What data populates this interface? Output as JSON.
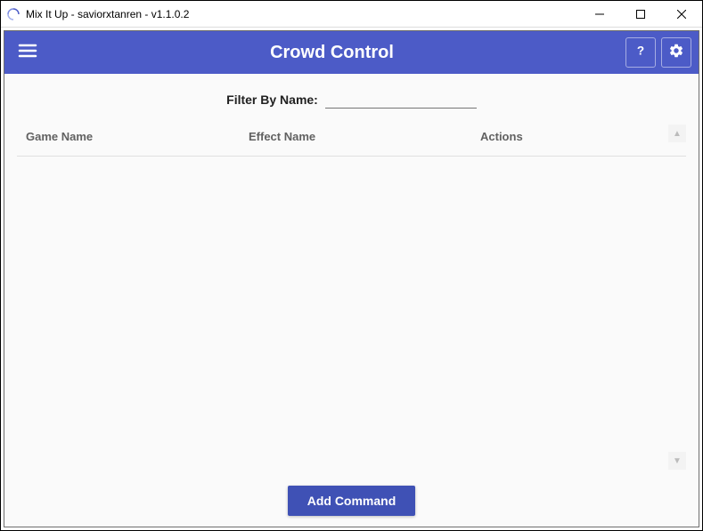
{
  "window": {
    "title": "Mix It Up - saviorxtanren - v1.1.0.2"
  },
  "header": {
    "title": "Crowd Control"
  },
  "filter": {
    "label": "Filter By Name:",
    "value": ""
  },
  "table": {
    "columns": {
      "game": "Game Name",
      "effect": "Effect Name",
      "actions": "Actions"
    },
    "rows": []
  },
  "footer": {
    "add_command_label": "Add Command"
  }
}
